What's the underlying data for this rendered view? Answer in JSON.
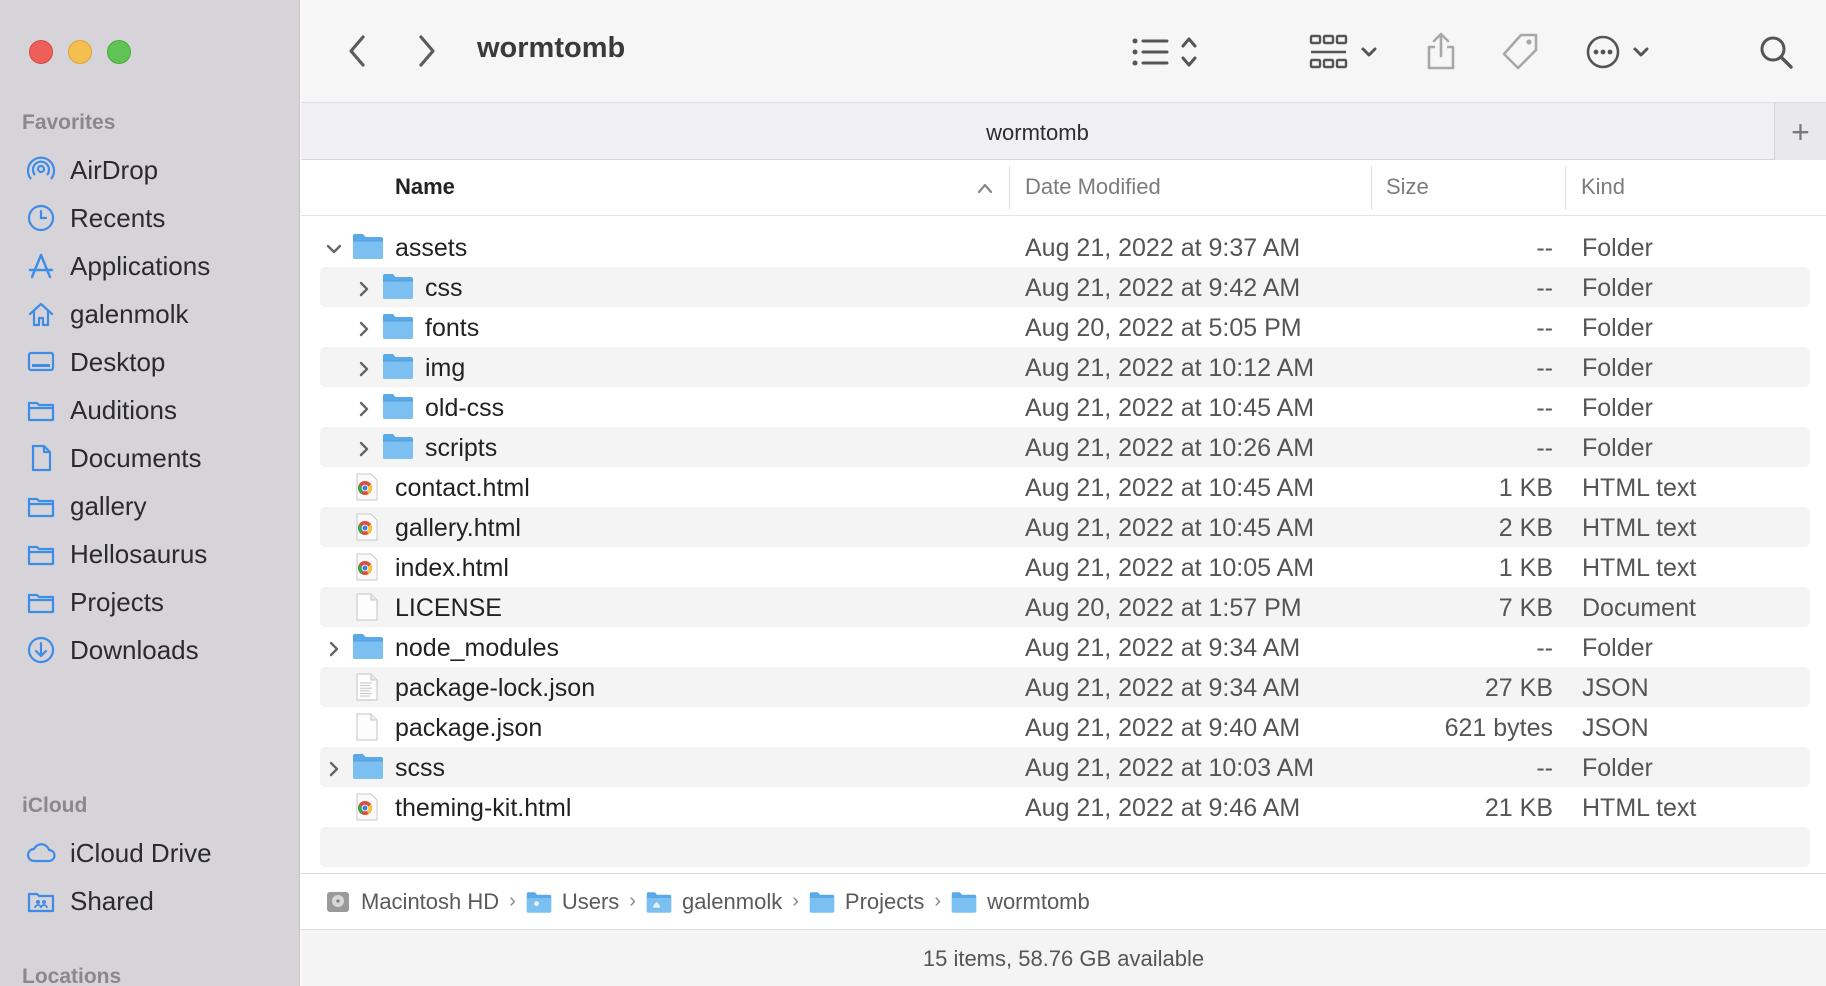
{
  "window": {
    "title": "wormtomb",
    "tab_title": "wormtomb"
  },
  "sidebar": {
    "favorites_header": "Favorites",
    "favorites": [
      {
        "label": "AirDrop",
        "icon": "airdrop-icon"
      },
      {
        "label": "Recents",
        "icon": "clock-icon"
      },
      {
        "label": "Applications",
        "icon": "applications-icon"
      },
      {
        "label": "galenmolk",
        "icon": "home-icon"
      },
      {
        "label": "Desktop",
        "icon": "desktop-icon"
      },
      {
        "label": "Auditions",
        "icon": "folder-icon"
      },
      {
        "label": "Documents",
        "icon": "document-icon"
      },
      {
        "label": "gallery",
        "icon": "folder-icon"
      },
      {
        "label": "Hellosaurus",
        "icon": "folder-icon"
      },
      {
        "label": "Projects",
        "icon": "folder-icon"
      },
      {
        "label": "Downloads",
        "icon": "download-icon"
      }
    ],
    "icloud_header": "iCloud",
    "icloud": [
      {
        "label": "iCloud Drive",
        "icon": "cloud-icon"
      },
      {
        "label": "Shared",
        "icon": "shared-folder-icon"
      }
    ],
    "locations_header": "Locations"
  },
  "columns": {
    "name": "Name",
    "date": "Date Modified",
    "size": "Size",
    "kind": "Kind"
  },
  "files": [
    {
      "name": "assets",
      "date": "Aug 21, 2022 at 9:37 AM",
      "size": "--",
      "kind": "Folder",
      "type": "folder",
      "level": 0,
      "disclosure": "open"
    },
    {
      "name": "css",
      "date": "Aug 21, 2022 at 9:42 AM",
      "size": "--",
      "kind": "Folder",
      "type": "folder",
      "level": 1,
      "disclosure": "closed"
    },
    {
      "name": "fonts",
      "date": "Aug 20, 2022 at 5:05 PM",
      "size": "--",
      "kind": "Folder",
      "type": "folder",
      "level": 1,
      "disclosure": "closed"
    },
    {
      "name": "img",
      "date": "Aug 21, 2022 at 10:12 AM",
      "size": "--",
      "kind": "Folder",
      "type": "folder",
      "level": 1,
      "disclosure": "closed"
    },
    {
      "name": "old-css",
      "date": "Aug 21, 2022 at 10:45 AM",
      "size": "--",
      "kind": "Folder",
      "type": "folder",
      "level": 1,
      "disclosure": "closed"
    },
    {
      "name": "scripts",
      "date": "Aug 21, 2022 at 10:26 AM",
      "size": "--",
      "kind": "Folder",
      "type": "folder",
      "level": 1,
      "disclosure": "closed"
    },
    {
      "name": "contact.html",
      "date": "Aug 21, 2022 at 10:45 AM",
      "size": "1 KB",
      "kind": "HTML text",
      "type": "html",
      "level": 0,
      "disclosure": "none"
    },
    {
      "name": "gallery.html",
      "date": "Aug 21, 2022 at 10:45 AM",
      "size": "2 KB",
      "kind": "HTML text",
      "type": "html",
      "level": 0,
      "disclosure": "none"
    },
    {
      "name": "index.html",
      "date": "Aug 21, 2022 at 10:05 AM",
      "size": "1 KB",
      "kind": "HTML text",
      "type": "html",
      "level": 0,
      "disclosure": "none"
    },
    {
      "name": "LICENSE",
      "date": "Aug 20, 2022 at 1:57 PM",
      "size": "7 KB",
      "kind": "Document",
      "type": "doc",
      "level": 0,
      "disclosure": "none"
    },
    {
      "name": "node_modules",
      "date": "Aug 21, 2022 at 9:34 AM",
      "size": "--",
      "kind": "Folder",
      "type": "folder",
      "level": 0,
      "disclosure": "closed"
    },
    {
      "name": "package-lock.json",
      "date": "Aug 21, 2022 at 9:34 AM",
      "size": "27 KB",
      "kind": "JSON",
      "type": "json",
      "level": 0,
      "disclosure": "none"
    },
    {
      "name": "package.json",
      "date": "Aug 21, 2022 at 9:40 AM",
      "size": "621 bytes",
      "kind": "JSON",
      "type": "doc",
      "level": 0,
      "disclosure": "none"
    },
    {
      "name": "scss",
      "date": "Aug 21, 2022 at 10:03 AM",
      "size": "--",
      "kind": "Folder",
      "type": "folder",
      "level": 0,
      "disclosure": "closed"
    },
    {
      "name": "theming-kit.html",
      "date": "Aug 21, 2022 at 9:46 AM",
      "size": "21 KB",
      "kind": "HTML text",
      "type": "html",
      "level": 0,
      "disclosure": "none"
    }
  ],
  "path": [
    {
      "label": "Macintosh HD",
      "icon": "hard-drive-icon"
    },
    {
      "label": "Users",
      "icon": "users-folder-icon"
    },
    {
      "label": "galenmolk",
      "icon": "home-folder-icon"
    },
    {
      "label": "Projects",
      "icon": "folder-icon"
    },
    {
      "label": "wormtomb",
      "icon": "folder-icon"
    }
  ],
  "status": "15 items, 58.76 GB available",
  "colors": {
    "accent": "#3d8ce8",
    "folder": "#68b3ec",
    "sidebar_bg": "#d6d4d9"
  }
}
